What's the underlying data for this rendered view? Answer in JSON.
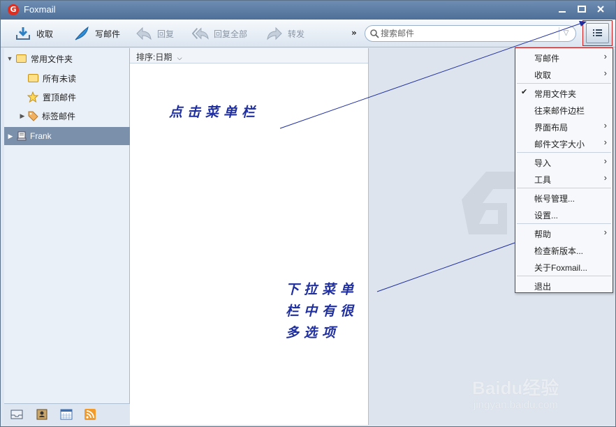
{
  "window": {
    "title": "Foxmail",
    "logo_letter": "G"
  },
  "toolbar": {
    "receive_label": "收取",
    "compose_label": "写邮件",
    "reply_label": "回复",
    "reply_all_label": "回复全部",
    "forward_label": "转发",
    "more_label": "»"
  },
  "search": {
    "placeholder": "搜索邮件",
    "value": ""
  },
  "sidebar": {
    "items": [
      {
        "label": "常用文件夹",
        "icon": "folder-icon"
      },
      {
        "label": "所有未读",
        "icon": "folder-icon"
      },
      {
        "label": "置顶邮件",
        "icon": "star-icon"
      },
      {
        "label": "标签邮件",
        "icon": "tag-icon"
      },
      {
        "label": "Frank",
        "icon": "account-icon",
        "selected": true
      }
    ]
  },
  "message_list": {
    "sort_label": "排序:日期"
  },
  "menu": {
    "items": [
      {
        "label": "写邮件",
        "submenu": true,
        "checked": false
      },
      {
        "label": "收取",
        "submenu": true,
        "checked": false
      },
      {
        "label": "常用文件夹",
        "submenu": false,
        "checked": true
      },
      {
        "label": "往来邮件边栏",
        "submenu": false,
        "checked": false
      },
      {
        "label": "界面布局",
        "submenu": true,
        "checked": false
      },
      {
        "label": "邮件文字大小",
        "submenu": true,
        "checked": false
      },
      {
        "label": "导入",
        "submenu": true,
        "checked": false
      },
      {
        "label": "工具",
        "submenu": true,
        "checked": false
      },
      {
        "label": "帐号管理...",
        "submenu": false,
        "checked": false
      },
      {
        "label": "设置...",
        "submenu": false,
        "checked": false
      },
      {
        "label": "帮助",
        "submenu": true,
        "checked": false
      },
      {
        "label": "检查新版本...",
        "submenu": false,
        "checked": false
      },
      {
        "label": "关于Foxmail...",
        "submenu": false,
        "checked": false
      },
      {
        "label": "退出",
        "submenu": false,
        "checked": false
      }
    ]
  },
  "annotations": {
    "click_menu": "点击菜单栏",
    "dropdown_note_line1": "下拉菜单",
    "dropdown_note_line2": "栏中有很",
    "dropdown_note_line3": "多选项"
  },
  "watermark": {
    "logo": "Baidu经验",
    "url": "jingyan.baidu.com"
  },
  "colors": {
    "titlebar": "#5a7aa3",
    "annotation": "#1f2fa0",
    "highlight_border": "#cc1a1a",
    "selected_item": "#7a90ab"
  }
}
